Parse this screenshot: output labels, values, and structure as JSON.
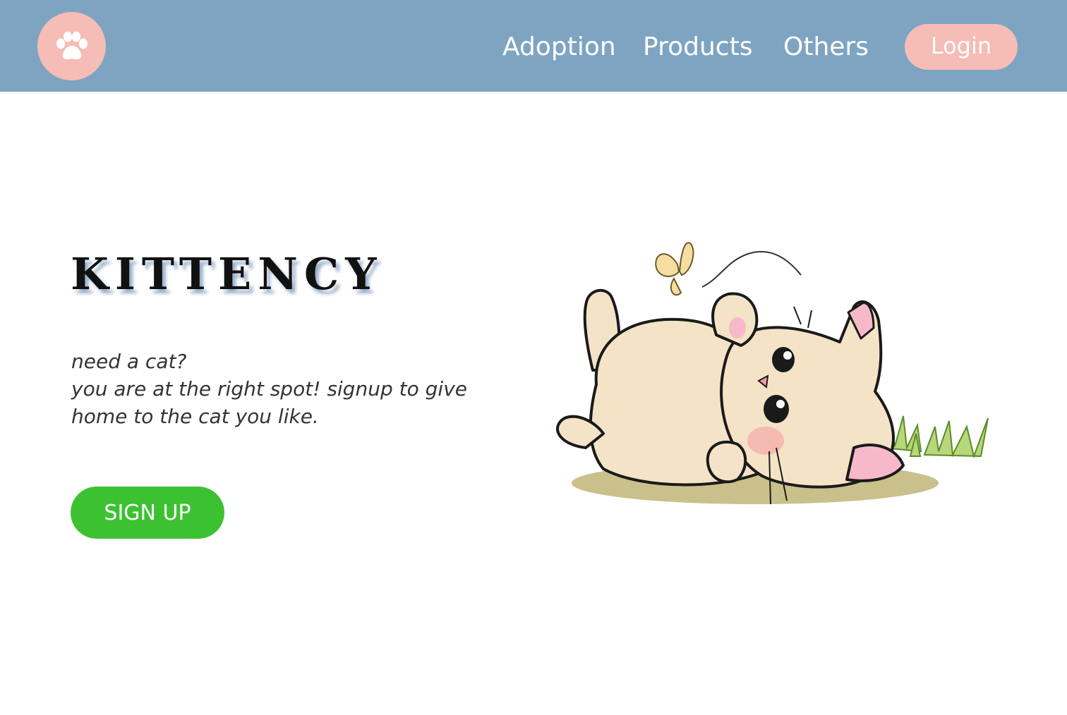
{
  "header": {
    "logo_icon": "paw-icon",
    "nav": {
      "adoption": "Adoption",
      "products": "Products",
      "others": "Others"
    },
    "login_label": "Login"
  },
  "hero": {
    "title": "KITTENCY",
    "tagline_lines": [
      "need a cat?",
      "you are at the right spot! signup to give",
      "home to the cat you like."
    ],
    "signup_label": "SIGN UP",
    "illustration": "cat-lying-on-grass-with-butterfly"
  },
  "colors": {
    "header_bg": "#7ea4c2",
    "accent_pink": "#f6bcb6",
    "signup_green": "#3cc231",
    "text_dark": "#333333"
  }
}
